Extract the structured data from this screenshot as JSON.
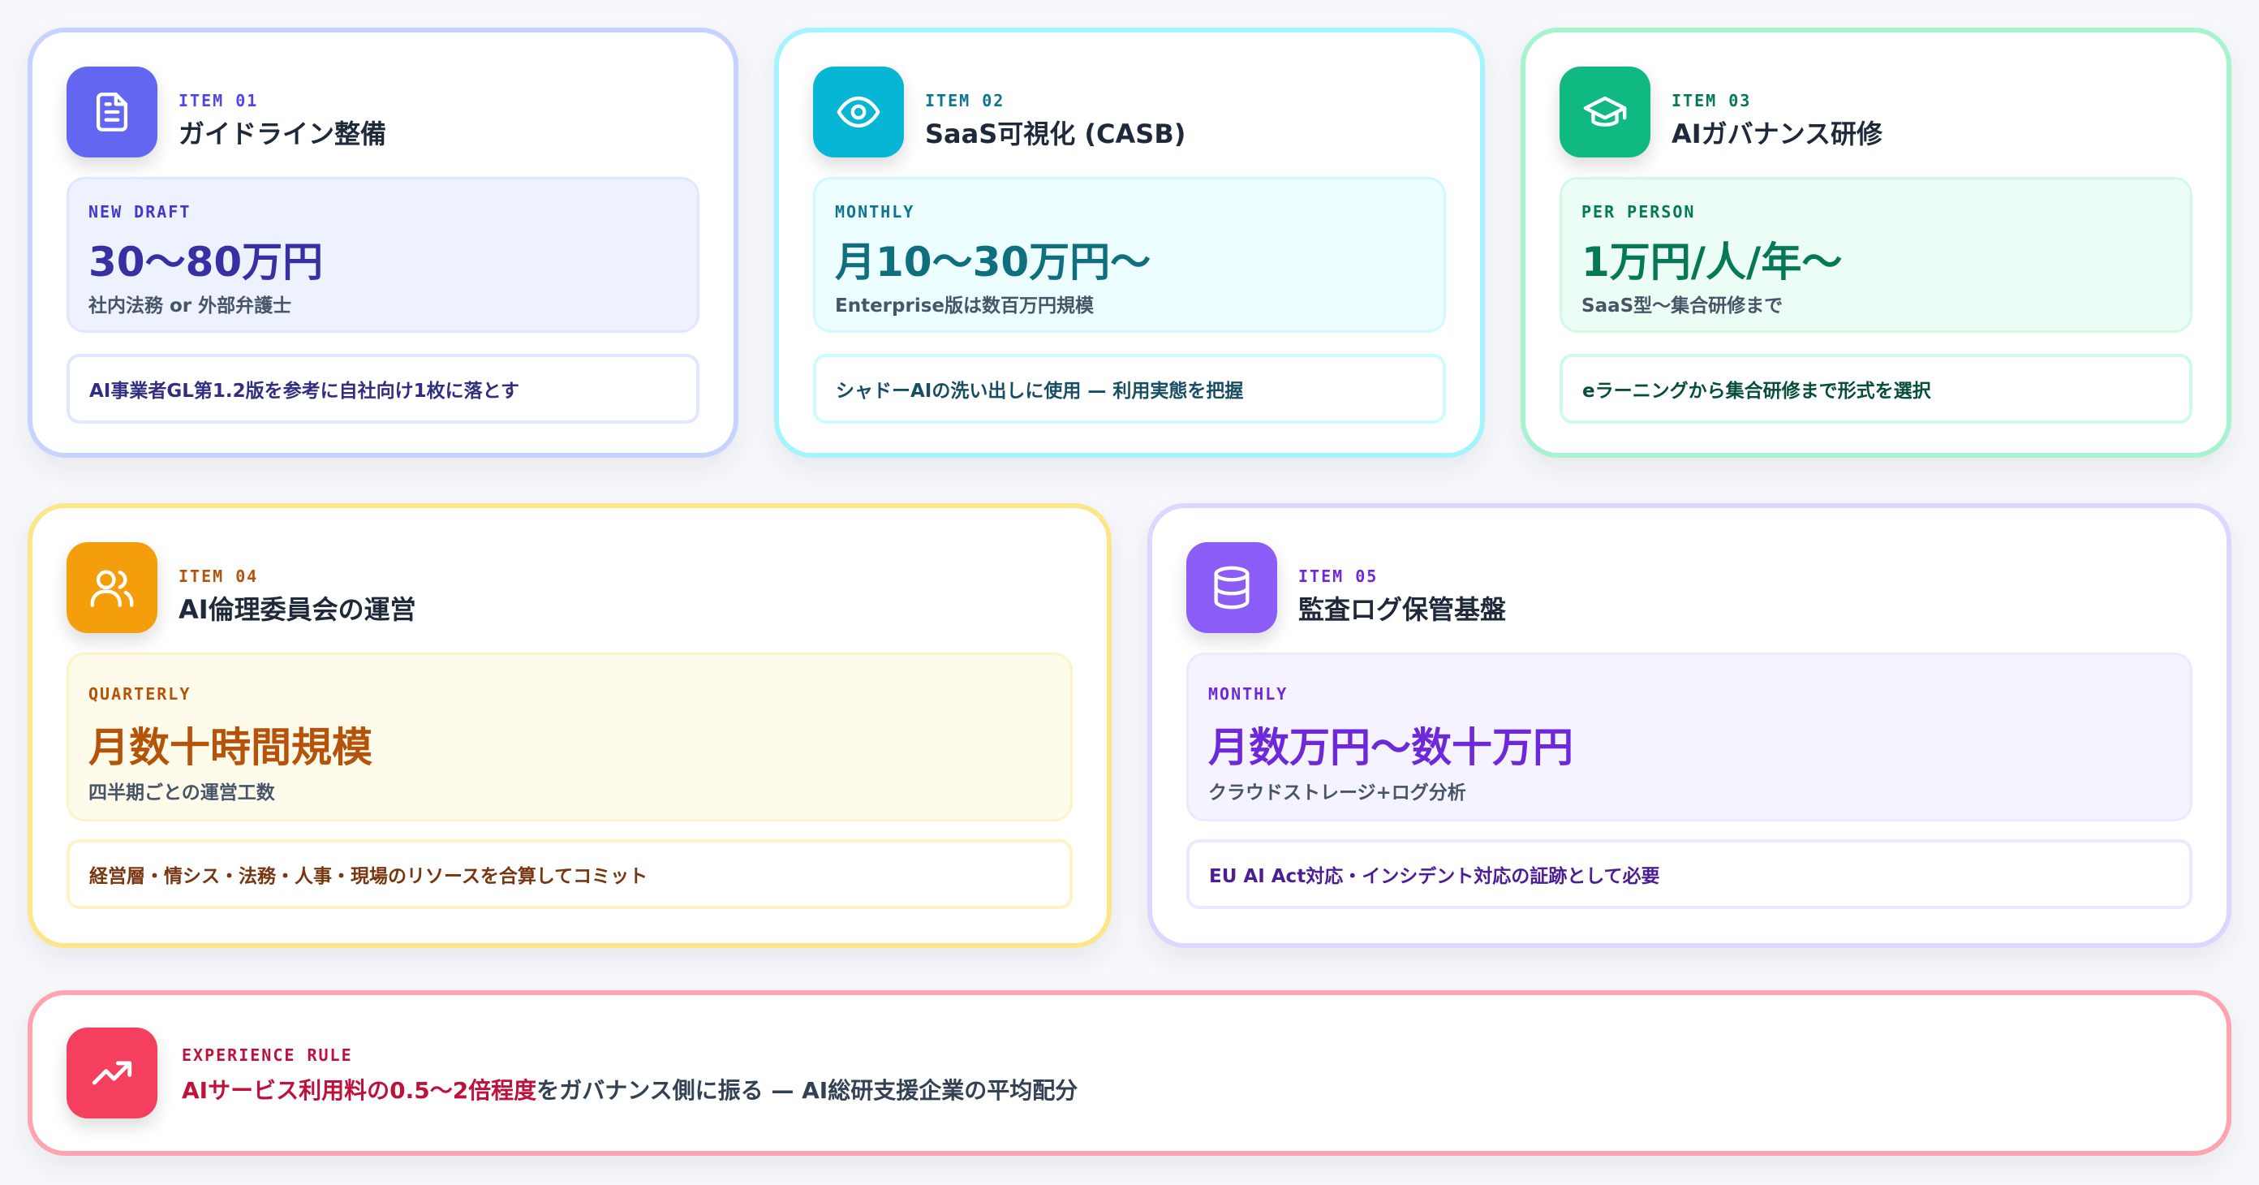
{
  "items": [
    {
      "label": "ITEM 01",
      "title": "ガイドライン整備",
      "icon": "document-icon",
      "tag": "NEW DRAFT",
      "price": "30〜80万円",
      "sub": "社内法務 or 外部弁護士",
      "note": "AI事業者GL第1.2版を参考に自社向け1枚に落とす",
      "color": "#6366f1"
    },
    {
      "label": "ITEM 02",
      "title": "SaaS可視化 (CASB)",
      "icon": "eye-icon",
      "tag": "MONTHLY",
      "price": "月10〜30万円〜",
      "sub": "Enterprise版は数百万円規模",
      "note": "シャドーAIの洗い出しに使用 — 利用実態を把握",
      "color": "#06b6d4"
    },
    {
      "label": "ITEM 03",
      "title": "AIガバナンス研修",
      "icon": "graduation-cap-icon",
      "tag": "PER PERSON",
      "price": "1万円/人/年〜",
      "sub": "SaaS型〜集合研修まで",
      "note": "eラーニングから集合研修まで形式を選択",
      "color": "#10b981"
    },
    {
      "label": "ITEM 04",
      "title": "AI倫理委員会の運営",
      "icon": "users-icon",
      "tag": "QUARTERLY",
      "price": "月数十時間規模",
      "sub": "四半期ごとの運営工数",
      "note": "経営層・情シス・法務・人事・現場のリソースを合算してコミット",
      "color": "#f59e0b"
    },
    {
      "label": "ITEM 05",
      "title": "監査ログ保管基盤",
      "icon": "database-icon",
      "tag": "MONTHLY",
      "price": "月数万円〜数十万円",
      "sub": "クラウドストレージ+ログ分析",
      "note": "EU AI Act対応・インシデント対応の証跡として必要",
      "color": "#8b5cf6"
    }
  ],
  "rule": {
    "tag": "EXPERIENCE RULE",
    "icon": "trending-up-icon",
    "highlight": "AIサービス利用料の0.5〜2倍程度",
    "rest": "をガバナンス側に振る — AI総研支援企業の平均配分",
    "color": "#f43f5e"
  }
}
